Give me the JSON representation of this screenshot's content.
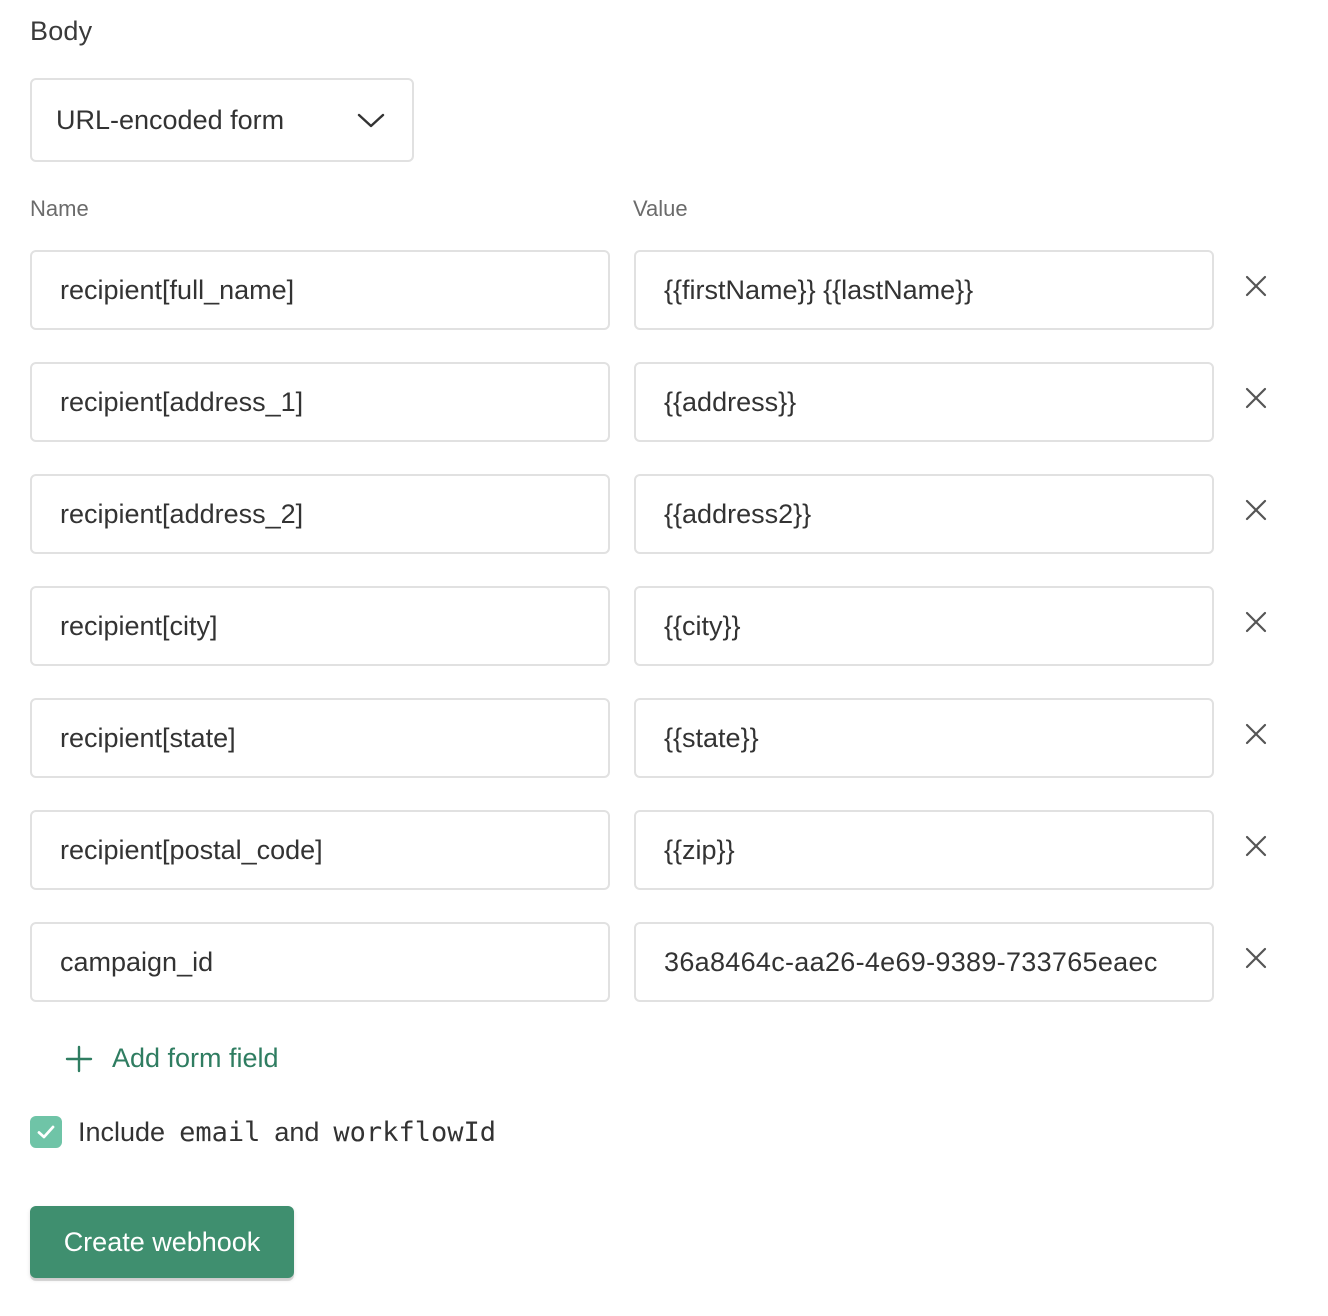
{
  "body": {
    "title": "Body",
    "select": {
      "value": "URL-encoded form",
      "icon": "chevron-down-icon"
    }
  },
  "columns": {
    "name": "Name",
    "value": "Value"
  },
  "fields": [
    {
      "name": "recipient[full_name]",
      "value": "{{firstName}} {{lastName}}"
    },
    {
      "name": "recipient[address_1]",
      "value": "{{address}}"
    },
    {
      "name": "recipient[address_2]",
      "value": "{{address2}}"
    },
    {
      "name": "recipient[city]",
      "value": "{{city}}"
    },
    {
      "name": "recipient[state]",
      "value": "{{state}}"
    },
    {
      "name": "recipient[postal_code]",
      "value": "{{zip}}"
    },
    {
      "name": "campaign_id",
      "value": "36a8464c-aa26-4e69-9389-733765eaec"
    }
  ],
  "add_field": {
    "label": "Add form field",
    "icon": "plus-icon"
  },
  "include": {
    "checked": true,
    "prefix": "Include",
    "code1": "email",
    "middle": "and",
    "code2": "workflowId"
  },
  "submit": {
    "label": "Create webhook"
  },
  "colors": {
    "accent": "#2f7d61",
    "button": "#3f8f6f",
    "checkbox": "#6fc4a7",
    "border": "#e1e1e1"
  }
}
